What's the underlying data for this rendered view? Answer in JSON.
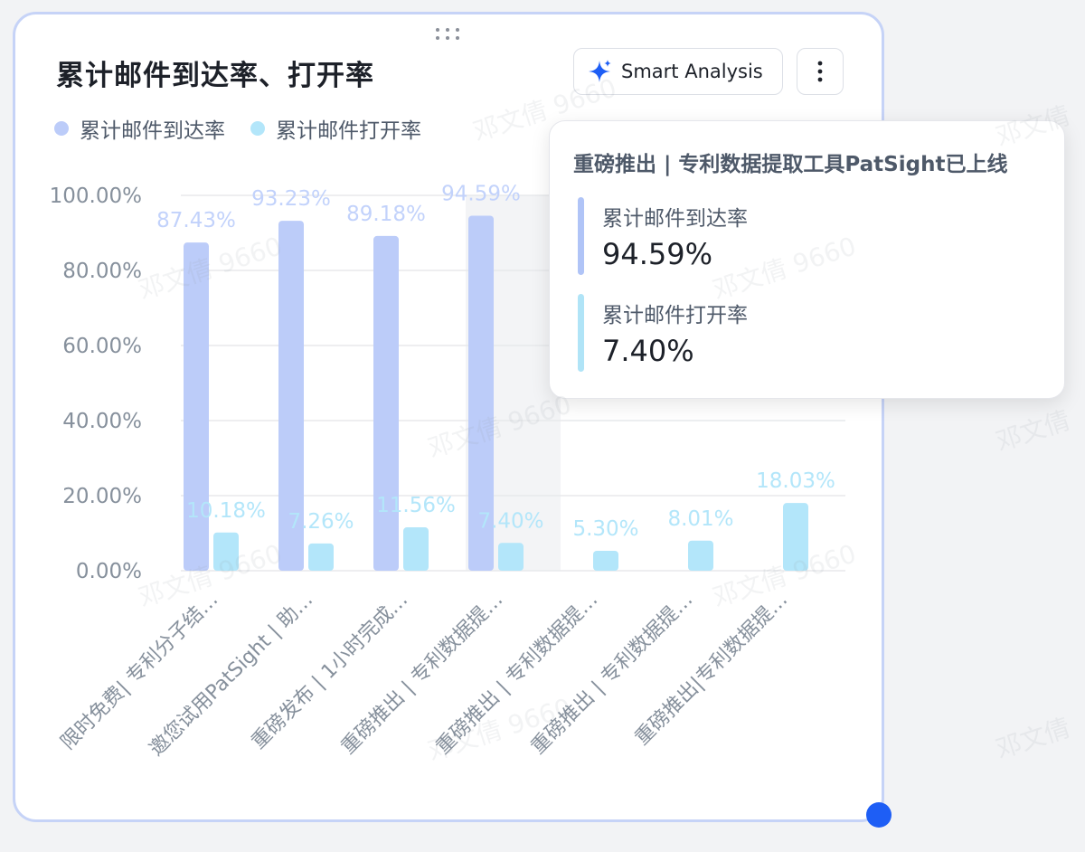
{
  "card": {
    "title": "累计邮件到达率、打开率",
    "smart_analysis_label": "Smart Analysis",
    "more_icon": "more-vertical-icon",
    "sparkle_icon": "sparkle-icon",
    "drag_icon": "drag-handle-icon"
  },
  "colors": {
    "arrival": "#bcccf9",
    "open": "#b3e6fa",
    "accent": "#1e5ef5",
    "tooltip_arrival_bar": "#b0c4f7",
    "tooltip_open_bar": "#b0e4f7"
  },
  "chart_data": {
    "type": "bar",
    "title": "累计邮件到达率、打开率",
    "categories": [
      "限时免费| 专利分子结…",
      "邀您试用PatSight | 助…",
      "重磅发布 | 1小时完成…",
      "重磅推出 | 专利数据提…",
      "重磅推出 | 专利数据提…",
      "重磅推出 | 专利数据提…",
      "重磅推出|专利数据提…"
    ],
    "series": [
      {
        "name": "累计邮件到达率",
        "values": [
          87.43,
          93.23,
          89.18,
          94.59,
          null,
          null,
          null
        ],
        "labels": [
          "87.43%",
          "93.23%",
          "89.18%",
          "94.59%",
          "",
          "",
          ""
        ]
      },
      {
        "name": "累计邮件打开率",
        "values": [
          10.18,
          7.26,
          11.56,
          7.4,
          5.3,
          8.01,
          18.03
        ],
        "labels": [
          "10.18%",
          "7.26%",
          "11.56%",
          "7.40%",
          "5.30%",
          "8.01%",
          "18.03%"
        ]
      }
    ],
    "yticks": [
      "0.00%",
      "20.00%",
      "40.00%",
      "60.00%",
      "80.00%",
      "100.00%"
    ],
    "ylim": [
      0,
      100
    ],
    "grid": true,
    "legend": "top-left",
    "highlight_index": 3
  },
  "tooltip": {
    "title": "重磅推出 | 专利数据提取工具PatSight已上线",
    "items": [
      {
        "name": "累计邮件到达率",
        "value": "94.59%"
      },
      {
        "name": "累计邮件打开率",
        "value": "7.40%"
      }
    ]
  },
  "watermark": {
    "text": "邓文倩 9660",
    "short_text": "邓文倩"
  }
}
